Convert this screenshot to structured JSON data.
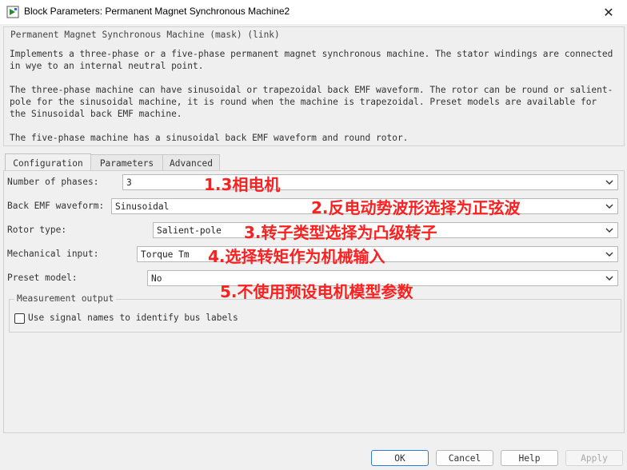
{
  "window": {
    "title": "Block Parameters: Permanent Magnet Synchronous Machine2",
    "close_icon": "close-icon"
  },
  "description": {
    "legend": "Permanent Magnet Synchronous Machine (mask) (link)",
    "paragraphs": [
      "Implements a three-phase or a five-phase permanent magnet synchronous machine. The stator windings are connected in wye to an internal neutral point.",
      "The three-phase machine can have sinusoidal or trapezoidal back EMF waveform. The rotor can be round or salient-pole for the sinusoidal machine, it is round when the machine is trapezoidal. Preset models are available for the Sinusoidal back EMF machine.",
      "The five-phase machine has a sinusoidal back EMF waveform and round rotor."
    ]
  },
  "tabs": [
    "Configuration",
    "Parameters",
    "Advanced"
  ],
  "active_tab": "Configuration",
  "fields": [
    {
      "label": "Number of phases:",
      "value": "3"
    },
    {
      "label": "Back EMF waveform:",
      "value": "Sinusoidal"
    },
    {
      "label": "Rotor type:",
      "value": "Salient-pole"
    },
    {
      "label": "Mechanical input:",
      "value": "Torque Tm"
    },
    {
      "label": "Preset model:",
      "value": "No"
    }
  ],
  "annotations": [
    "1.3相电机",
    "2.反电动势波形选择为正弦波",
    "3.转子类型选择为凸级转子",
    "4.选择转矩作为机械输入",
    "5.不使用预设电机模型参数"
  ],
  "measurement": {
    "legend": "Measurement output",
    "checkbox_label": "Use signal names to identify bus labels",
    "checked": false
  },
  "buttons": {
    "ok": "OK",
    "cancel": "Cancel",
    "help": "Help",
    "apply": "Apply"
  },
  "colors": {
    "annotation": "#ff2020",
    "ok_border": "#2f7dd1"
  }
}
